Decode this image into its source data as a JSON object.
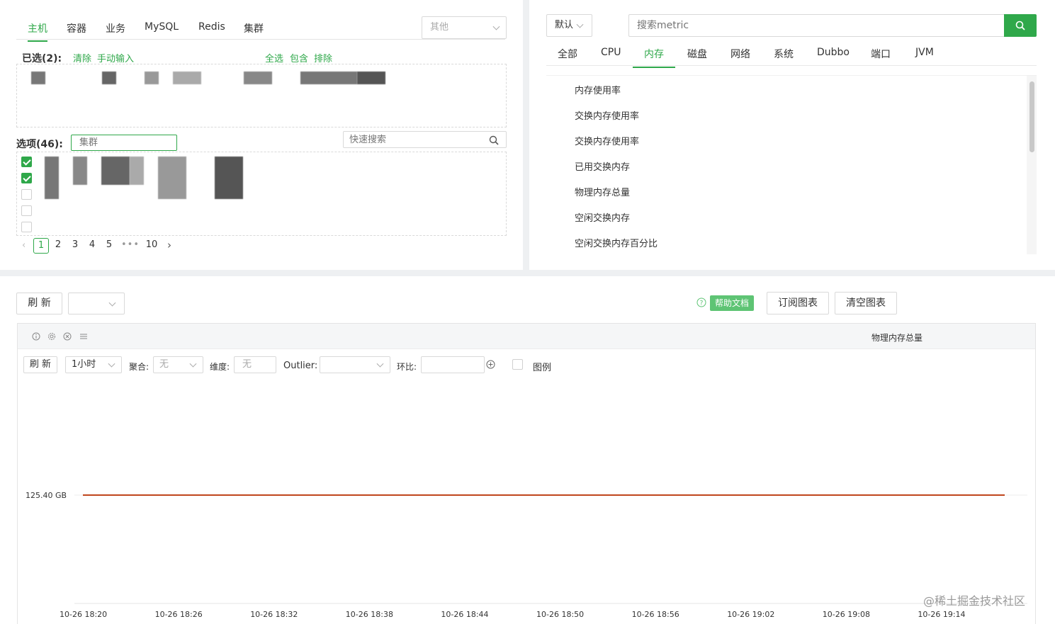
{
  "left": {
    "tabs": [
      "主机",
      "容器",
      "业务",
      "MySQL",
      "Redis",
      "集群"
    ],
    "active_tab": 0,
    "other_select": "其他",
    "selected_label": "已选(2):",
    "clear_link": "清除",
    "manual_input_link": "手动输入",
    "select_all_link": "全选",
    "include_link": "包含",
    "exclude_link": "排除",
    "options_label": "选项(46):",
    "cluster_placeholder": "集群",
    "quick_search_placeholder": "快速搜索",
    "checkboxes": [
      true,
      true,
      false,
      false,
      false
    ],
    "pages": [
      "1",
      "2",
      "3",
      "4",
      "5",
      "•••",
      "10"
    ],
    "active_page": "1"
  },
  "right": {
    "default_select": "默认",
    "search_placeholder": "搜索metric",
    "tabs": [
      "全部",
      "CPU",
      "内存",
      "磁盘",
      "网络",
      "系统",
      "Dubbo",
      "端口",
      "JVM"
    ],
    "active_tab": 2,
    "metrics": [
      "内存使用率",
      "交换内存使用率",
      "交换内存使用率",
      "已用交换内存",
      "物理内存总量",
      "空闲交换内存",
      "空闲交换内存百分比"
    ]
  },
  "bottom": {
    "refresh": "刷 新",
    "help_doc": "帮助文档",
    "subscribe": "订阅图表",
    "clear_charts": "清空图表",
    "chart_title": "物理内存总量",
    "inner_refresh": "刷 新",
    "time_range": "1小时",
    "agg_label": "聚合:",
    "agg_value": "无",
    "dim_label": "维度:",
    "dim_value": "无",
    "outlier_label": "Outlier:",
    "ratio_label": "环比:",
    "legend_label": "图例",
    "watermark": "@稀土掘金技术社区"
  },
  "chart_data": {
    "type": "line",
    "x": [
      "10-26 18:20",
      "10-26 18:26",
      "10-26 18:32",
      "10-26 18:38",
      "10-26 18:44",
      "10-26 18:50",
      "10-26 18:56",
      "10-26 19:02",
      "10-26 19:08",
      "10-26 19:14"
    ],
    "y_tick_labels": [
      "125.40 GB"
    ],
    "series": [
      {
        "values": [
          125.4,
          125.4,
          125.4,
          125.4,
          125.4,
          125.4,
          125.4,
          125.4,
          125.4,
          125.4
        ],
        "color": "#c0451c"
      }
    ],
    "grid": true
  },
  "colors": {
    "accent": "#2fa84a",
    "line": "#c0451c"
  }
}
